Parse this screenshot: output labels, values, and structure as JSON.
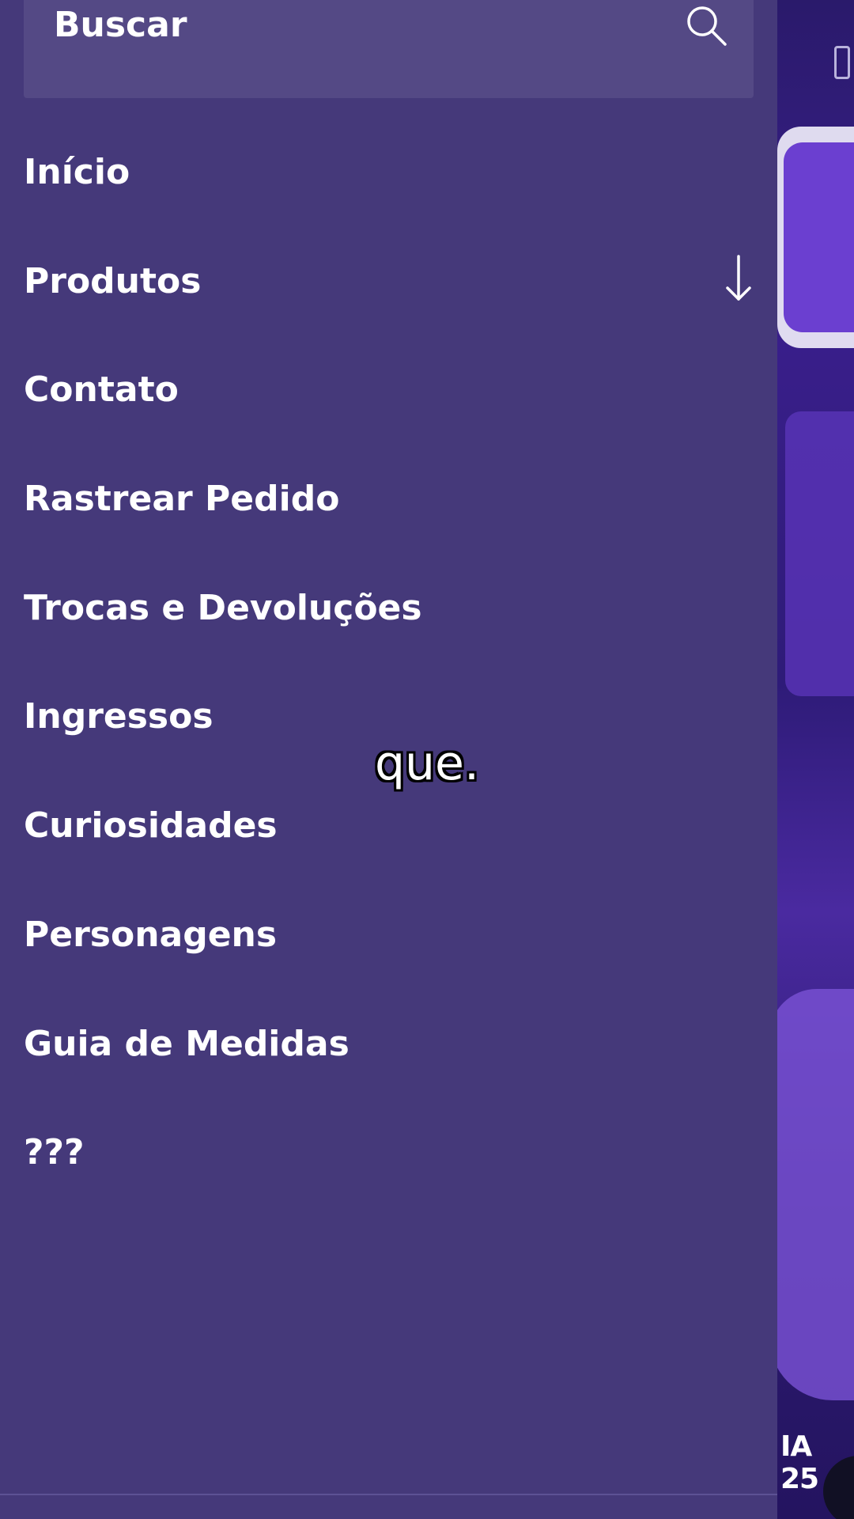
{
  "search": {
    "label": "Buscar"
  },
  "menu": {
    "items": [
      {
        "label": "Início"
      },
      {
        "label": "Produtos"
      },
      {
        "label": "Contato"
      },
      {
        "label": "Rastrear Pedido"
      },
      {
        "label": "Trocas e Devoluções"
      },
      {
        "label": "Ingressos"
      },
      {
        "label": "Curiosidades"
      },
      {
        "label": "Personagens"
      },
      {
        "label": "Guia de Medidas"
      },
      {
        "label": "???"
      }
    ]
  },
  "subtitle": {
    "text": "que."
  },
  "background_page": {
    "partial_text": "IA 25"
  },
  "colors": {
    "drawer_bg": "#45397a",
    "search_bg": "#544985",
    "text": "#ffffff"
  }
}
